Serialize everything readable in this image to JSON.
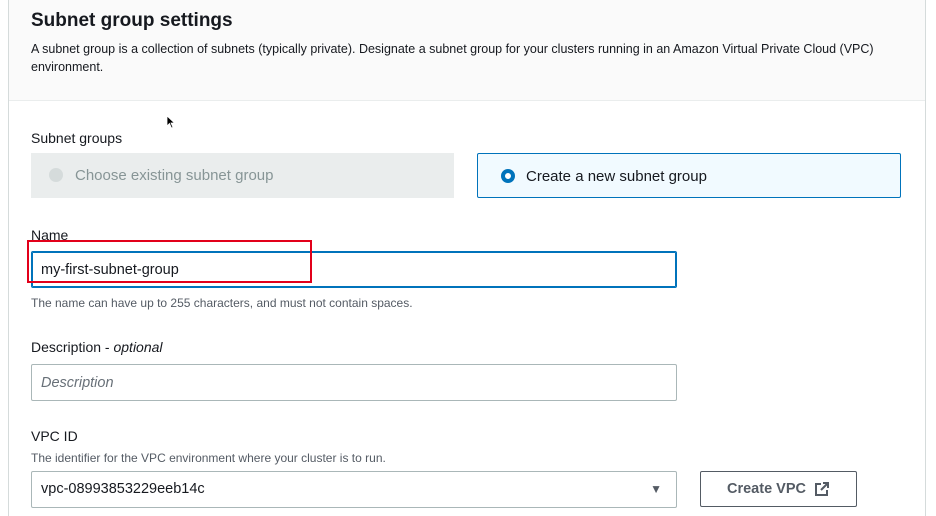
{
  "section": {
    "title": "Subnet group settings",
    "description": "A subnet group is a collection of subnets (typically private). Designate a subnet group for your clusters running in an Amazon Virtual Private Cloud (VPC) environment."
  },
  "subnet_groups": {
    "label": "Subnet groups",
    "options": [
      {
        "label": "Choose existing subnet group",
        "state": "disabled"
      },
      {
        "label": "Create a new subnet group",
        "state": "selected"
      }
    ]
  },
  "name_field": {
    "label": "Name",
    "value": "my-first-subnet-group",
    "hint": "The name can have up to 255 characters, and must not contain spaces."
  },
  "description_field": {
    "label": "Description",
    "label_suffix": "optional",
    "separator": " - ",
    "placeholder": "Description"
  },
  "vpc_field": {
    "label": "VPC ID",
    "hint": "The identifier for the VPC environment where your cluster is to run.",
    "value": "vpc-08993853229eeb14c",
    "caret_icon": "caret-down-icon"
  },
  "create_vpc_button": {
    "label": "Create VPC",
    "icon": "external-link-icon"
  },
  "colors": {
    "accent": "#0073bb",
    "highlight_box": "#e2001a",
    "disabled_tile": "#eaeded",
    "selected_tile": "#f1faff"
  }
}
